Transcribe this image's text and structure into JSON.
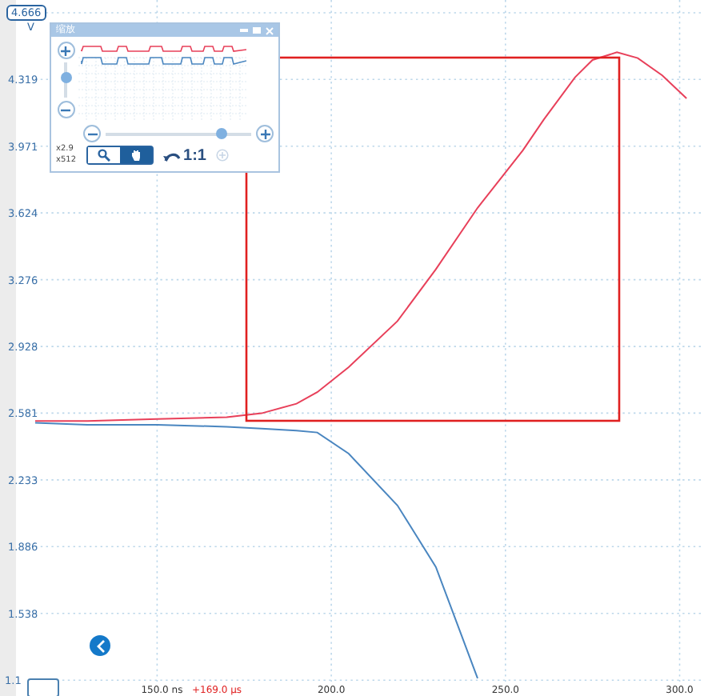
{
  "plot": {
    "unit": "V",
    "marker_label": "4.666",
    "cursor_offset": "+169.0 µs",
    "bottom_tick_label": "1.1",
    "selection": {
      "color": "#e02020"
    },
    "chart_data": {
      "type": "line",
      "x": [
        115,
        130,
        150,
        170,
        180,
        190,
        196,
        205,
        219,
        230,
        242,
        255,
        261,
        270,
        275,
        282,
        288,
        295,
        302
      ],
      "series": [
        {
          "color": "#e8405a",
          "values": [
            2.54,
            2.54,
            2.55,
            2.56,
            2.58,
            2.63,
            2.69,
            2.82,
            3.06,
            3.33,
            3.65,
            3.95,
            4.11,
            4.33,
            4.42,
            4.46,
            4.43,
            4.34,
            4.22
          ]
        },
        {
          "color": "#4a86c0",
          "values": [
            2.53,
            2.52,
            2.52,
            2.51,
            2.5,
            2.49,
            2.48,
            2.37,
            2.1,
            1.78,
            1.2,
            null,
            null,
            null,
            null,
            null,
            null,
            null,
            null
          ]
        }
      ],
      "xlim": [
        115,
        307
      ],
      "grid": true,
      "ylim": [
        1.19,
        4.666
      ],
      "xticks": [
        {
          "value": 150,
          "label": "150.0 ns"
        },
        {
          "value": 200,
          "label": "200.0"
        },
        {
          "value": 250,
          "label": "250.0"
        },
        {
          "value": 300,
          "label": "300.0"
        }
      ],
      "yticks": [
        {
          "value": 4.319,
          "label": "4.319"
        },
        {
          "value": 3.971,
          "label": "3.971"
        },
        {
          "value": 3.624,
          "label": "3.624"
        },
        {
          "value": 3.276,
          "label": "3.276"
        },
        {
          "value": 2.928,
          "label": "2.928"
        },
        {
          "value": 2.581,
          "label": "2.581"
        },
        {
          "value": 2.233,
          "label": "2.233"
        },
        {
          "value": 1.886,
          "label": "1.886"
        },
        {
          "value": 1.538,
          "label": "1.538"
        }
      ]
    }
  },
  "overview": {
    "title": "缩放",
    "vertical_zoom": {
      "level": 0.55
    },
    "horizontal_zoom": {
      "level": 0.8
    },
    "zoom_x": "x2.9",
    "zoom_y": "x512",
    "modes": [
      {
        "kind": "magnify",
        "selected": false
      },
      {
        "kind": "pan",
        "selected": true
      }
    ],
    "reset_label": "1:1"
  }
}
